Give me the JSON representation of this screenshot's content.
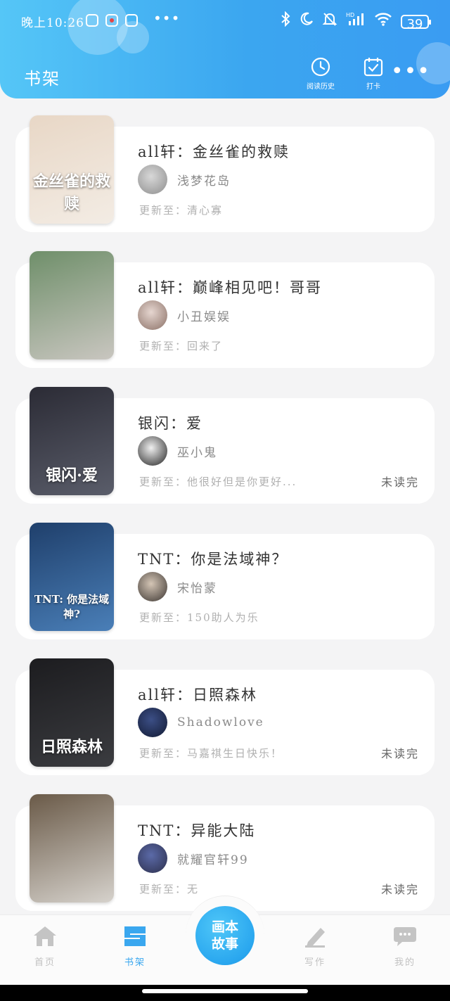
{
  "status_bar": {
    "time": "晚上10:26",
    "more": "•••",
    "battery": "39"
  },
  "header": {
    "title": "书架",
    "actions": [
      {
        "label": "阅读历史",
        "icon": "clock-icon"
      },
      {
        "label": "打卡",
        "icon": "calendar-check-icon"
      }
    ],
    "more": "•••"
  },
  "books": [
    {
      "title": "all轩：金丝雀的救赎",
      "author": "浅梦花岛",
      "update": "更新至：清心寡",
      "unread": "",
      "cover_text": "金丝雀的救赎",
      "cover_colors": [
        "#e8d7c6",
        "#f3ece4"
      ],
      "avatar_colors": [
        "#d8d8d8",
        "#8d8d8d"
      ]
    },
    {
      "title": "all轩：巅峰相见吧！哥哥",
      "author": "小丑娱娱",
      "update": "更新至：回来了",
      "unread": "",
      "cover_text": "",
      "cover_colors": [
        "#6f8f6a",
        "#c9c6c0"
      ],
      "avatar_colors": [
        "#e6d6d0",
        "#8a7066"
      ]
    },
    {
      "title": "银闪：爱",
      "author": "巫小鬼",
      "update": "更新至：他很好但是你更好...",
      "unread": "未读完",
      "cover_text": "银闪·爱",
      "cover_colors": [
        "#2b2b35",
        "#5a5d6a"
      ],
      "avatar_colors": [
        "#f0f0f0",
        "#222222"
      ]
    },
    {
      "title": "TNT：你是法域神？",
      "author": "宋怡蒙",
      "update": "更新至：150助人为乐",
      "unread": "",
      "cover_text": "TNT: 你是法域神?",
      "cover_colors": [
        "#1f3f6b",
        "#4a7fb8"
      ],
      "avatar_colors": [
        "#d4c5b5",
        "#3a3430"
      ]
    },
    {
      "title": "all轩：日照森林",
      "author": "Shadowlove",
      "update": "更新至：马嘉祺生日快乐！",
      "unread": "未读完",
      "cover_text": "日照森林",
      "cover_colors": [
        "#1c1c1f",
        "#3b3c40"
      ],
      "avatar_colors": [
        "#3c4f86",
        "#121a33"
      ]
    },
    {
      "title": "TNT：异能大陆",
      "author": "就耀官轩99",
      "update": "更新至：无",
      "unread": "未读完",
      "cover_text": "",
      "cover_colors": [
        "#6a5a48",
        "#d6d2cc"
      ],
      "avatar_colors": [
        "#5b6aa8",
        "#2c2f4c"
      ]
    }
  ],
  "bottom_nav": {
    "items": [
      {
        "label": "首页",
        "icon": "home-icon",
        "active": false
      },
      {
        "label": "书架",
        "icon": "bookshelf-icon",
        "active": true
      },
      {
        "label": "写作",
        "icon": "pen-icon",
        "active": false
      },
      {
        "label": "我的",
        "icon": "chat-bubble-icon",
        "active": false
      }
    ],
    "center_button": {
      "line1": "画本",
      "line2": "故事"
    }
  },
  "colors": {
    "accent": "#3aa7ef",
    "header_start": "#55c6f7",
    "header_end": "#3a9cf2",
    "background": "#f4f4f5"
  }
}
